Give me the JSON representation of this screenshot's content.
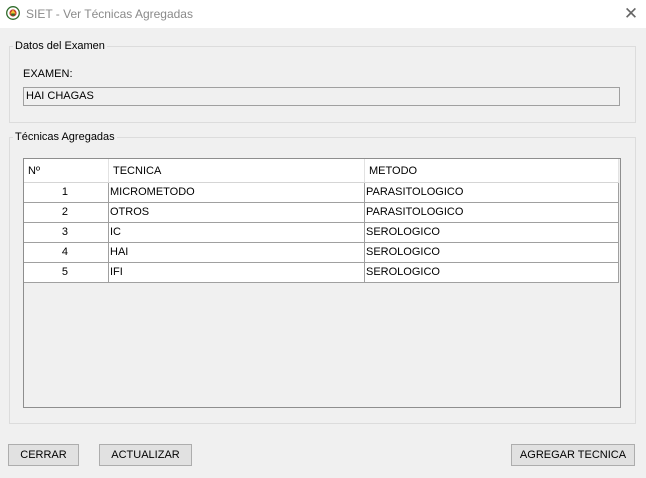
{
  "window": {
    "title": "SIET - Ver Técnicas Agregadas",
    "icon": "siet-logo-icon",
    "close_glyph": "✕"
  },
  "datos_examen": {
    "legend": "Datos del Examen",
    "examen_label": "EXAMEN:",
    "examen_value": "HAI CHAGAS"
  },
  "tecnicas": {
    "legend": "Técnicas Agregadas",
    "columns": [
      "Nº",
      "TECNICA",
      "METODO"
    ],
    "rows": [
      {
        "n": "1",
        "tecnica": "MICROMETODO",
        "metodo": "PARASITOLOGICO"
      },
      {
        "n": "2",
        "tecnica": "OTROS",
        "metodo": "PARASITOLOGICO"
      },
      {
        "n": "3",
        "tecnica": "IC",
        "metodo": "SEROLOGICO"
      },
      {
        "n": "4",
        "tecnica": "HAI",
        "metodo": "SEROLOGICO"
      },
      {
        "n": "5",
        "tecnica": "IFI",
        "metodo": "SEROLOGICO"
      }
    ]
  },
  "buttons": {
    "cerrar": "CERRAR",
    "actualizar": "ACTUALIZAR",
    "agregar": "AGREGAR TECNICA"
  }
}
